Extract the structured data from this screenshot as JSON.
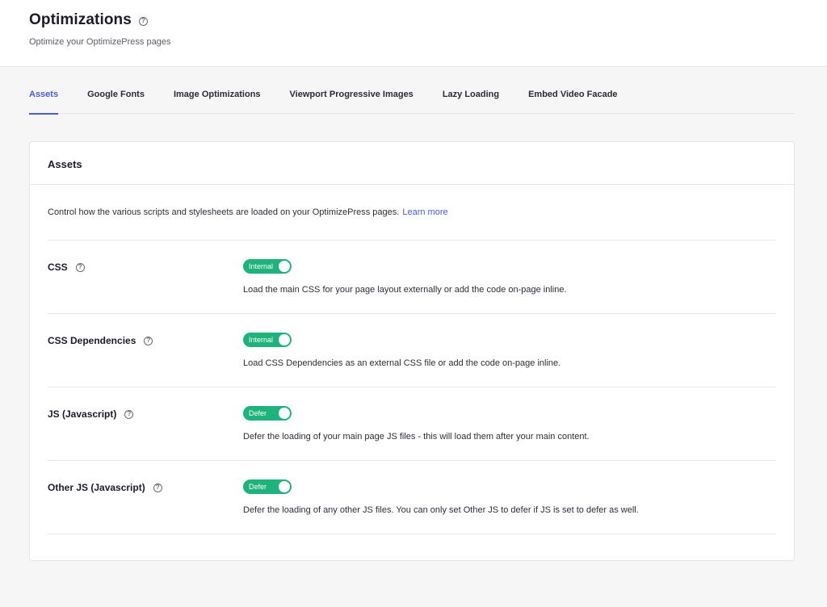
{
  "header": {
    "title": "Optimizations",
    "help_glyph": "?",
    "subtitle": "Optimize your OptimizePress pages"
  },
  "tabs": [
    {
      "label": "Assets",
      "active": true
    },
    {
      "label": "Google Fonts"
    },
    {
      "label": "Image Optimizations"
    },
    {
      "label": "Viewport Progressive Images"
    },
    {
      "label": "Lazy Loading"
    },
    {
      "label": "Embed Video Facade"
    }
  ],
  "card": {
    "title": "Assets",
    "intro": "Control how the various scripts and stylesheets are loaded on your OptimizePress pages.",
    "learn_more": "Learn more",
    "settings": [
      {
        "label": "CSS",
        "toggle": "Internal",
        "description": "Load the main CSS for your page layout externally or add the code on-page inline."
      },
      {
        "label": "CSS Dependencies",
        "toggle": "Internal",
        "description": "Load CSS Dependencies as an external CSS file or add the code on-page inline."
      },
      {
        "label": "JS (Javascript)",
        "toggle": "Defer",
        "description": "Defer the loading of your main page JS files - this will load them after your main content."
      },
      {
        "label": "Other JS (Javascript)",
        "toggle": "Defer",
        "description": "Defer the loading of any other JS files. You can only set Other JS to defer if JS is set to defer as well."
      }
    ]
  },
  "colors": {
    "accent": "#4a5be0",
    "toggle_on": "#1fb37c"
  },
  "icons": {
    "help": "question-circle-icon"
  }
}
